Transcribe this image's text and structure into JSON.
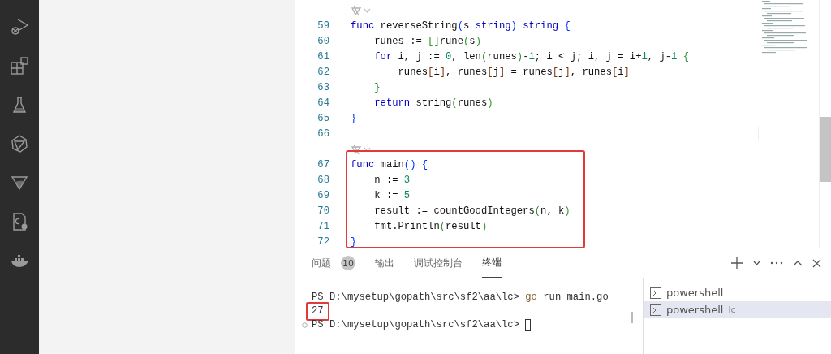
{
  "editor": {
    "blocks": [
      {
        "lens": true,
        "boxed": false,
        "current": false,
        "lines": [
          {
            "number": "59",
            "tokens": [
              {
                "kind": "kw",
                "t": "func"
              },
              {
                "kind": "id",
                "t": " reverseString"
              },
              {
                "kind": "b1",
                "t": "("
              },
              {
                "kind": "id",
                "t": "s "
              },
              {
                "kind": "kw",
                "t": "string"
              },
              {
                "kind": "b1",
                "t": ")"
              },
              {
                "kind": "kw",
                "t": " string"
              },
              {
                "kind": "b1",
                "t": " {"
              }
            ]
          },
          {
            "number": "60",
            "tokens": [
              {
                "kind": "id",
                "t": "    runes := "
              },
              {
                "kind": "b2",
                "t": "[]"
              },
              {
                "kind": "id",
                "t": "rune"
              },
              {
                "kind": "b2",
                "t": "("
              },
              {
                "kind": "id",
                "t": "s"
              },
              {
                "kind": "b2",
                "t": ")"
              }
            ]
          },
          {
            "number": "61",
            "tokens": [
              {
                "kind": "kw",
                "t": "    for"
              },
              {
                "kind": "id",
                "t": " i, j := "
              },
              {
                "kind": "num",
                "t": "0"
              },
              {
                "kind": "id",
                "t": ", len"
              },
              {
                "kind": "b2",
                "t": "("
              },
              {
                "kind": "id",
                "t": "runes"
              },
              {
                "kind": "b2",
                "t": ")"
              },
              {
                "kind": "id",
                "t": "-"
              },
              {
                "kind": "num",
                "t": "1"
              },
              {
                "kind": "id",
                "t": "; i < j; i, j = i+"
              },
              {
                "kind": "num",
                "t": "1"
              },
              {
                "kind": "id",
                "t": ", j-"
              },
              {
                "kind": "num",
                "t": "1"
              },
              {
                "kind": "b2",
                "t": " {"
              }
            ]
          },
          {
            "number": "62",
            "tokens": [
              {
                "kind": "id",
                "t": "        runes"
              },
              {
                "kind": "b3",
                "t": "["
              },
              {
                "kind": "id",
                "t": "i"
              },
              {
                "kind": "b3",
                "t": "]"
              },
              {
                "kind": "id",
                "t": ", runes"
              },
              {
                "kind": "b3",
                "t": "["
              },
              {
                "kind": "id",
                "t": "j"
              },
              {
                "kind": "b3",
                "t": "]"
              },
              {
                "kind": "id",
                "t": " = runes"
              },
              {
                "kind": "b3",
                "t": "["
              },
              {
                "kind": "id",
                "t": "j"
              },
              {
                "kind": "b3",
                "t": "]"
              },
              {
                "kind": "id",
                "t": ", runes"
              },
              {
                "kind": "b3",
                "t": "["
              },
              {
                "kind": "id",
                "t": "i"
              },
              {
                "kind": "b3",
                "t": "]"
              }
            ]
          },
          {
            "number": "63",
            "tokens": [
              {
                "kind": "b2",
                "t": "    }"
              }
            ]
          },
          {
            "number": "64",
            "tokens": [
              {
                "kind": "kw",
                "t": "    return"
              },
              {
                "kind": "id",
                "t": " string"
              },
              {
                "kind": "b2",
                "t": "("
              },
              {
                "kind": "id",
                "t": "runes"
              },
              {
                "kind": "b2",
                "t": ")"
              }
            ]
          },
          {
            "number": "65",
            "tokens": [
              {
                "kind": "b1",
                "t": "}"
              }
            ]
          }
        ]
      },
      {
        "lens": false,
        "boxed": false,
        "current": true,
        "lines": [
          {
            "number": "66"
          }
        ]
      },
      {
        "lens": true,
        "boxed": true,
        "current": false,
        "lines": [
          {
            "number": "67",
            "tokens": [
              {
                "kind": "kw",
                "t": "func"
              },
              {
                "kind": "id",
                "t": " main"
              },
              {
                "kind": "b1",
                "t": "()"
              },
              {
                "kind": "b1",
                "t": " {"
              }
            ]
          },
          {
            "number": "68",
            "tokens": [
              {
                "kind": "id",
                "t": "    n := "
              },
              {
                "kind": "num",
                "t": "3"
              }
            ]
          },
          {
            "number": "69",
            "tokens": [
              {
                "kind": "id",
                "t": "    k := "
              },
              {
                "kind": "num",
                "t": "5"
              }
            ]
          },
          {
            "number": "70",
            "tokens": [
              {
                "kind": "id",
                "t": "    result := countGoodIntegers"
              },
              {
                "kind": "b2",
                "t": "("
              },
              {
                "kind": "id",
                "t": "n, k"
              },
              {
                "kind": "b2",
                "t": ")"
              }
            ]
          },
          {
            "number": "71",
            "tokens": [
              {
                "kind": "id",
                "t": "    fmt.Println"
              },
              {
                "kind": "b2",
                "t": "("
              },
              {
                "kind": "id",
                "t": "result"
              },
              {
                "kind": "b2",
                "t": ")"
              }
            ]
          },
          {
            "number": "72",
            "tokens": [
              {
                "kind": "b1",
                "t": "}"
              }
            ]
          }
        ]
      }
    ]
  },
  "panel": {
    "tabs": [
      {
        "label": "问题",
        "badge": "10",
        "selected": false
      },
      {
        "label": "输出",
        "selected": false
      },
      {
        "label": "调试控制台",
        "selected": false
      },
      {
        "label": "终端",
        "selected": true
      }
    ],
    "terminal": {
      "lines": [
        {
          "boxed": false,
          "marker": false,
          "cursor": false,
          "segments": [
            {
              "kind": "plain",
              "t": "PS D:\\mysetup\\gopath\\src\\sf2\\aa\\lc> "
            },
            {
              "kind": "cmd",
              "t": "go"
            },
            {
              "kind": "plain",
              "t": " run main.go"
            }
          ]
        },
        {
          "boxed": true,
          "marker": false,
          "cursor": false,
          "segments": [
            {
              "kind": "plain",
              "t": "27"
            }
          ]
        },
        {
          "boxed": false,
          "marker": true,
          "cursor": true,
          "segments": [
            {
              "kind": "plain",
              "t": "PS D:\\mysetup\\gopath\\src\\sf2\\aa\\lc> "
            }
          ]
        }
      ]
    },
    "terminal_list": [
      {
        "name": "powershell",
        "selected": false
      },
      {
        "name": "powershell",
        "suffix": "lc",
        "selected": true
      }
    ]
  }
}
